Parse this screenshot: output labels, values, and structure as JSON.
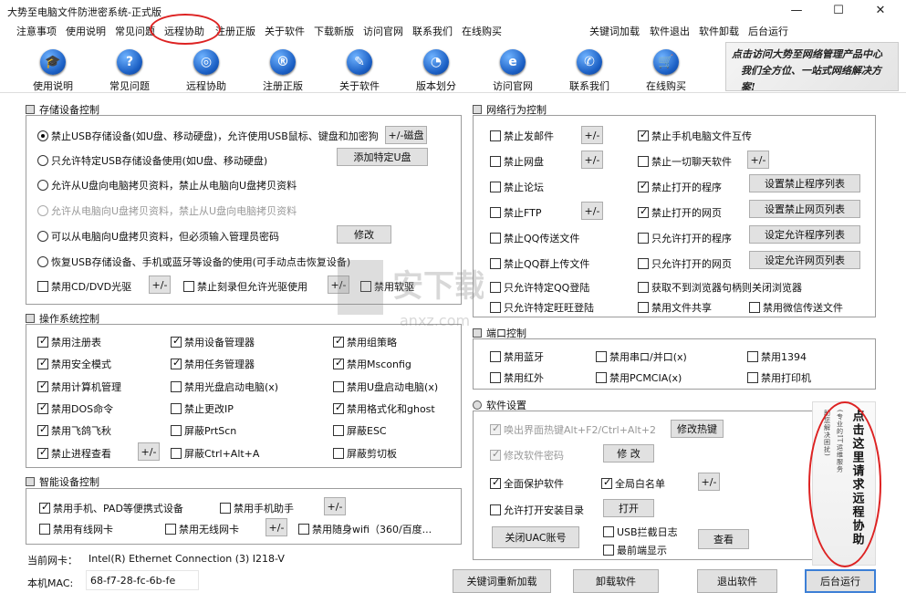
{
  "window": {
    "title": "大势至电脑文件防泄密系统-正式版",
    "minimize": "—",
    "maximize": "☐",
    "close": "✕"
  },
  "menu": {
    "items": [
      "注意事项",
      "使用说明",
      "常见问题",
      "远程协助",
      "注册正版",
      "关于软件",
      "下载新版",
      "访问官网",
      "联系我们",
      "在线购买"
    ],
    "right_items": [
      "关键词加载",
      "软件退出",
      "软件卸载",
      "后台运行"
    ]
  },
  "toolbar": {
    "items": [
      {
        "label": "使用说明",
        "icon": "graduation-cap-icon",
        "glyph": "🎓"
      },
      {
        "label": "常见问题",
        "icon": "question-icon",
        "glyph": "?"
      },
      {
        "label": "远程协助",
        "icon": "globe-icon",
        "glyph": "◎"
      },
      {
        "label": "注册正版",
        "icon": "registered-icon",
        "glyph": "®"
      },
      {
        "label": "关于软件",
        "icon": "notepad-icon",
        "glyph": "✎"
      },
      {
        "label": "版本划分",
        "icon": "pie-chart-icon",
        "glyph": "◔"
      },
      {
        "label": "访问官网",
        "icon": "browser-icon",
        "glyph": "e"
      },
      {
        "label": "联系我们",
        "icon": "chat-icon",
        "glyph": "✆"
      },
      {
        "label": "在线购买",
        "icon": "cart-icon",
        "glyph": "🛒"
      }
    ],
    "calligraphy_line1": "点击访问大势至网络管理产品中心",
    "calligraphy_line2": "我们全方位、一站式网络解决方案!"
  },
  "storage": {
    "title": "存储设备控制",
    "radios": [
      {
        "label": "禁止USB存储设备(如U盘、移动硬盘)，允许使用USB鼠标、键盘和加密狗",
        "checked": true,
        "disabled": false
      },
      {
        "label": "只允许特定USB存储设备使用(如U盘、移动硬盘)",
        "checked": false,
        "disabled": false
      },
      {
        "label": "允许从U盘向电脑拷贝资料，禁止从电脑向U盘拷贝资料",
        "checked": false,
        "disabled": false
      },
      {
        "label": "允许从电脑向U盘拷贝资料，禁止从U盘向电脑拷贝资料",
        "checked": false,
        "disabled": true
      },
      {
        "label": "可以从电脑向U盘拷贝资料，但必须输入管理员密码",
        "checked": false,
        "disabled": false
      },
      {
        "label": "恢复USB存储设备、手机或蓝牙等设备的使用(可手动点击恢复设备)",
        "checked": false,
        "disabled": false
      }
    ],
    "btn_udisk": "+/-磁盘",
    "btn_add_u": "添加特定U盘",
    "btn_modify": "修改",
    "cd_disable": "禁用CD/DVD光驱",
    "cd_burn": "禁止刻录但允许光驱使用",
    "floppy": "禁用软驱",
    "plusminus": "+/-"
  },
  "os": {
    "title": "操作系统控制",
    "items": [
      {
        "label": "禁用注册表",
        "checked": true
      },
      {
        "label": "禁用设备管理器",
        "checked": true
      },
      {
        "label": "禁用组策略",
        "checked": true
      },
      {
        "label": "禁用安全模式",
        "checked": true
      },
      {
        "label": "禁用任务管理器",
        "checked": true
      },
      {
        "label": "禁用Msconfig",
        "checked": true
      },
      {
        "label": "禁用计算机管理",
        "checked": true
      },
      {
        "label": "禁用光盘启动电脑(x)",
        "checked": false
      },
      {
        "label": "禁用U盘启动电脑(x)",
        "checked": false
      },
      {
        "label": "禁用DOS命令",
        "checked": true
      },
      {
        "label": "禁止更改IP",
        "checked": false
      },
      {
        "label": "禁用格式化和ghost",
        "checked": true
      },
      {
        "label": "禁用飞鸽飞秋",
        "checked": true
      },
      {
        "label": "屏蔽PrtScn",
        "checked": false
      },
      {
        "label": "屏蔽ESC",
        "checked": false
      },
      {
        "label": "禁止进程查看",
        "checked": true
      },
      {
        "label": "屏蔽Ctrl+Alt+A",
        "checked": false
      },
      {
        "label": "屏蔽剪切板",
        "checked": false
      }
    ],
    "plusminus": "+/-"
  },
  "smart": {
    "title": "智能设备控制",
    "phone": "禁用手机、PAD等便携式设备",
    "phone_helper": "禁用手机助手",
    "wired": "禁用有线网卡",
    "wireless": "禁用无线网卡",
    "wifi": "禁用随身wifi（360/百度...",
    "plusminus": "+/-"
  },
  "nic": {
    "label": "当前网卡：",
    "value": "Intel(R) Ethernet Connection (3) I218-V"
  },
  "mac": {
    "label": "本机MAC:",
    "value": "68-f7-28-fc-6b-fe"
  },
  "network": {
    "title": "网络行为控制",
    "left": [
      {
        "label": "禁止发邮件",
        "checked": false,
        "pm": true
      },
      {
        "label": "禁止网盘",
        "checked": false,
        "pm": true
      },
      {
        "label": "禁止论坛",
        "checked": false,
        "pm": false
      },
      {
        "label": "禁止FTP",
        "checked": false,
        "pm": true
      },
      {
        "label": "禁止QQ传送文件",
        "checked": false,
        "pm": false
      },
      {
        "label": "禁止QQ群上传文件",
        "checked": false,
        "pm": false
      },
      {
        "label": "只允许特定QQ登陆",
        "checked": false,
        "pm": false
      },
      {
        "label": "只允许特定旺旺登陆",
        "checked": false,
        "pm": false
      }
    ],
    "right": [
      {
        "label": "禁止手机电脑文件互传",
        "checked": true,
        "btn": ""
      },
      {
        "label": "禁止一切聊天软件",
        "checked": false,
        "btn": "+/-"
      },
      {
        "label": "禁止打开的程序",
        "checked": true,
        "btn": "设置禁止程序列表"
      },
      {
        "label": "禁止打开的网页",
        "checked": true,
        "btn": "设置禁止网页列表"
      },
      {
        "label": "只允许打开的程序",
        "checked": false,
        "btn": "设定允许程序列表"
      },
      {
        "label": "只允许打开的网页",
        "checked": false,
        "btn": "设定允许网页列表"
      },
      {
        "label": "获取不到浏览器句柄则关闭浏览器",
        "checked": false,
        "btn": ""
      },
      {
        "label": "禁用文件共享",
        "checked": false,
        "btn": ""
      }
    ],
    "wechat": "禁用微信传送文件",
    "plusminus": "+/-"
  },
  "ports": {
    "title": "端口控制",
    "items": [
      "禁用蓝牙",
      "禁用串口/并口(x)",
      "禁用1394",
      "禁用红外",
      "禁用PCMCIA(x)",
      "禁用打印机"
    ]
  },
  "settings": {
    "title": "软件设置",
    "hotkey_label": "唤出界面热键Alt+F2/Ctrl+Alt+2",
    "hotkey_btn": "修改热键",
    "pwd_label": "修改软件密码",
    "pwd_btn": "修 改",
    "full_protect": "全面保护软件",
    "whitelist": "全局白名单",
    "plusminus": "+/-",
    "allow_dir": "允许打开安装目录",
    "open_btn": "打开",
    "uac_btn": "关闭UAC账号",
    "usb_log": "USB拦截日志",
    "front": "最前端显示",
    "view_btn": "查看",
    "art_main": "点击这里请求远程协助",
    "art_side1": "(专业的IT运维服务",
    "art_side2": "助您解决困扰)"
  },
  "bottom": {
    "reload": "关键词重新加载",
    "uninstall": "卸载软件",
    "exit": "退出软件",
    "background": "后台运行"
  },
  "watermark": {
    "main": "安下载",
    "sub": "anxz.com"
  },
  "colors": {
    "accent": "#3c7fd6",
    "annotation_red": "#d22222",
    "icon_blue": "#1b5fc4"
  }
}
